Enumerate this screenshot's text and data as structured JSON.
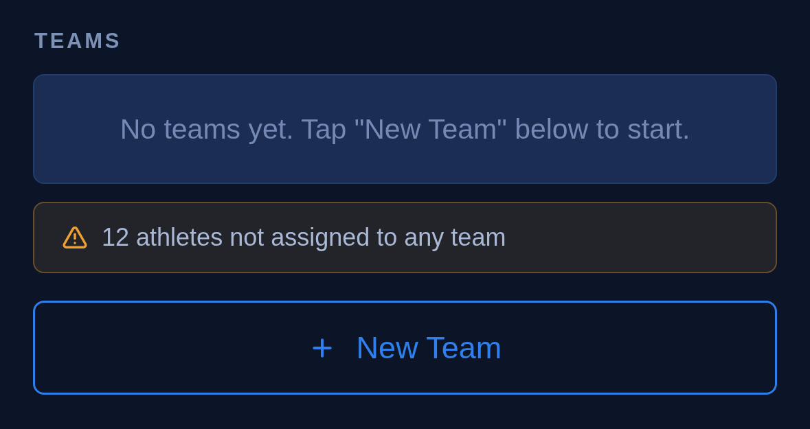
{
  "section": {
    "heading": "TEAMS"
  },
  "empty_state": {
    "message": "No teams yet. Tap \"New Team\" below to start."
  },
  "warning": {
    "message": "12 athletes not assigned to any team"
  },
  "new_team_button": {
    "label": "New Team"
  }
}
